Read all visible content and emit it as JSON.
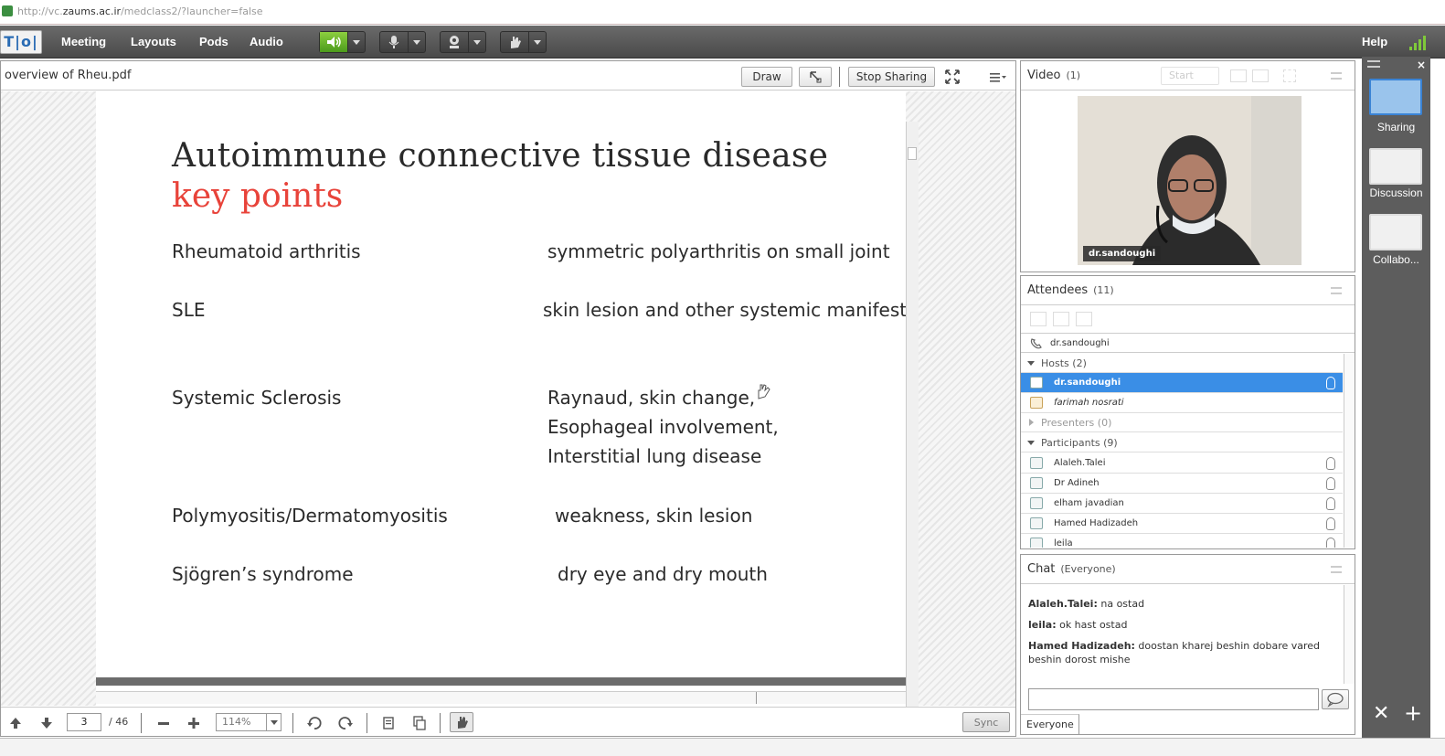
{
  "browser": {
    "url_prefix": "http://vc.",
    "url_host": "zaums.ac.ir",
    "url_path": "/medclass2/?launcher=false"
  },
  "menubar": {
    "logo": "T|o|",
    "items": [
      "Meeting",
      "Layouts",
      "Pods",
      "Audio"
    ],
    "help": "Help"
  },
  "share_pod": {
    "title": "overview of Rheu.pdf",
    "draw_label": "Draw",
    "stop_sharing_label": "Stop Sharing",
    "slide": {
      "title": "Autoimmune connective tissue disease",
      "subtitle": "key points",
      "rows": [
        {
          "left": "Rheumatoid arthritis",
          "right": [
            "symmetric polyarthritis on small joint"
          ]
        },
        {
          "left": "SLE",
          "right": [
            "skin lesion and other systemic manifestɑ"
          ]
        },
        {
          "left": "Systemic Sclerosis",
          "right": [
            "Raynaud, skin change,",
            "Esophageal involvement,",
            "Interstitial lung disease"
          ]
        },
        {
          "left": "Polymyositis/Dermatomyositis",
          "right": [
            "weakness, skin lesion"
          ]
        },
        {
          "left": "Sjögren’s syndrome",
          "right": [
            "dry eye and dry mouth"
          ]
        }
      ]
    },
    "footer": {
      "page_current": "3",
      "page_total": "/ 46",
      "zoom": "114%",
      "sync_label": "Sync"
    }
  },
  "video_pod": {
    "title": "Video",
    "count": "(1)",
    "start_label": "Start",
    "presenter_name": "dr.sandoughi"
  },
  "attendees_pod": {
    "title": "Attendees",
    "count": "(11)",
    "speaking": "dr.sandoughi",
    "hosts_label": "Hosts (2)",
    "hosts": [
      "dr.sandoughi",
      "farimah nosrati"
    ],
    "presenters_label": "Presenters (0)",
    "participants_label": "Participants (9)",
    "participants": [
      "Alaleh.Talei",
      "Dr Adineh",
      "elham javadian",
      "Hamed Hadizadeh",
      "leila"
    ]
  },
  "chat_pod": {
    "title": "Chat",
    "scope": "(Everyone)",
    "messages": [
      {
        "sender": "Alaleh.Talei:",
        "text": " na ostad"
      },
      {
        "sender": "leila:",
        "text": " ok hast ostad"
      },
      {
        "sender": "Hamed Hadizadeh:",
        "text": " doostan kharej beshin dobare vared beshin dorost mishe"
      }
    ],
    "recipient": "Everyone"
  },
  "layouts": [
    {
      "label": "Sharing",
      "selected": true
    },
    {
      "label": "Discussion",
      "selected": false
    },
    {
      "label": "Collabo...",
      "selected": false
    }
  ],
  "colors": {
    "accent_blue": "#3a8ee6",
    "speaker_green": "#6cbb2e",
    "subtitle_red": "#e8433a"
  }
}
